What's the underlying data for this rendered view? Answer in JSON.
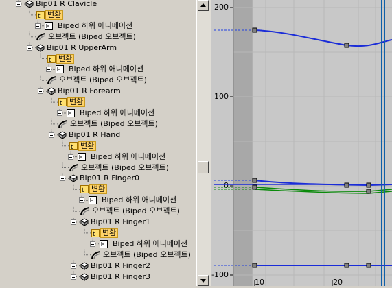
{
  "tree": {
    "rows": [
      {
        "type": "bone",
        "label": "Bip01 R Clavicle"
      },
      {
        "type": "xform",
        "label": "변환"
      },
      {
        "type": "sub",
        "label": "Biped 하위 애니메이션"
      },
      {
        "type": "obj",
        "label": "오브젝트 (Biped 오브젝트)"
      },
      {
        "type": "bone",
        "label": "Bip01 R UpperArm"
      },
      {
        "type": "xform",
        "label": "변환"
      },
      {
        "type": "sub",
        "label": "Biped 하위 애니메이션"
      },
      {
        "type": "obj",
        "label": "오브젝트 (Biped 오브젝트)"
      },
      {
        "type": "bone",
        "label": "Bip01 R Forearm"
      },
      {
        "type": "xform",
        "label": "변환"
      },
      {
        "type": "sub",
        "label": "Biped 하위 애니메이션"
      },
      {
        "type": "obj",
        "label": "오브젝트 (Biped 오브젝트)"
      },
      {
        "type": "bone",
        "label": "Bip01 R Hand"
      },
      {
        "type": "xform",
        "label": "변환"
      },
      {
        "type": "sub",
        "label": "Biped 하위 애니메이션"
      },
      {
        "type": "obj",
        "label": "오브젝트 (Biped 오브젝트)"
      },
      {
        "type": "bone",
        "label": "Bip01 R Finger0"
      },
      {
        "type": "xform",
        "label": "변환"
      },
      {
        "type": "sub",
        "label": "Biped 하위 애니메이션"
      },
      {
        "type": "obj",
        "label": "오브젝트 (Biped 오브젝트)"
      },
      {
        "type": "bone",
        "label": "Bip01 R Finger1"
      },
      {
        "type": "xform",
        "label": "변환"
      },
      {
        "type": "sub",
        "label": "Biped 하위 애니메이션"
      },
      {
        "type": "obj",
        "label": "오브젝트 (Biped 오브젝트)"
      },
      {
        "type": "bone",
        "label": "Bip01 R Finger2"
      },
      {
        "type": "bone",
        "label": "Bip01 R Finger3"
      }
    ]
  },
  "curve_editor": {
    "y_labels": [
      "200",
      "100",
      "0",
      "-100"
    ],
    "x_labels": [
      "10",
      "20"
    ],
    "colors": {
      "blue": "#1a2cd8",
      "green": "#0a8a0a",
      "marker": "#1060a8",
      "panel": "#c8c8c8",
      "inactive": "#a8a8a8"
    }
  }
}
